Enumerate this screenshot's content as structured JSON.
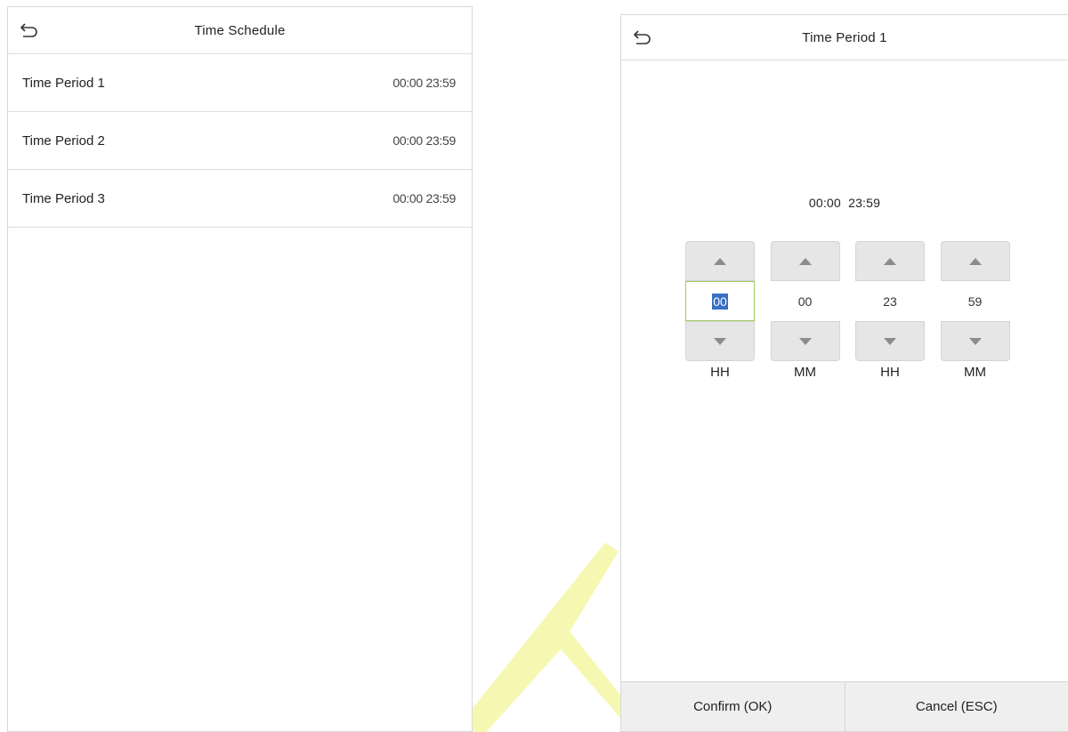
{
  "left_screen": {
    "header": {
      "title": "Time Schedule",
      "back_icon": "back-arrow-icon"
    },
    "periods": [
      {
        "label": "Time Period 1",
        "value": "00:00 23:59"
      },
      {
        "label": "Time Period 2",
        "value": "00:00 23:59"
      },
      {
        "label": "Time Period 3",
        "value": "00:00 23:59"
      }
    ]
  },
  "right_screen": {
    "header": {
      "title": "Time Period 1",
      "back_icon": "back-arrow-icon"
    },
    "period_display": "00:00  23:59",
    "spinners": [
      {
        "value": "00",
        "unit": "HH",
        "selected": true
      },
      {
        "value": "00",
        "unit": "MM",
        "selected": false
      },
      {
        "value": "23",
        "unit": "HH",
        "selected": false
      },
      {
        "value": "59",
        "unit": "MM",
        "selected": false
      }
    ],
    "buttons": {
      "confirm": "Confirm (OK)",
      "cancel": "Cancel (ESC)"
    }
  },
  "colors": {
    "watermark": "#f3f78a",
    "spinner_button": "#e6e6e6",
    "selected_border": "#9ccc5a",
    "selection_highlight": "#3a6fc4",
    "bottom_bar": "#efefef"
  }
}
